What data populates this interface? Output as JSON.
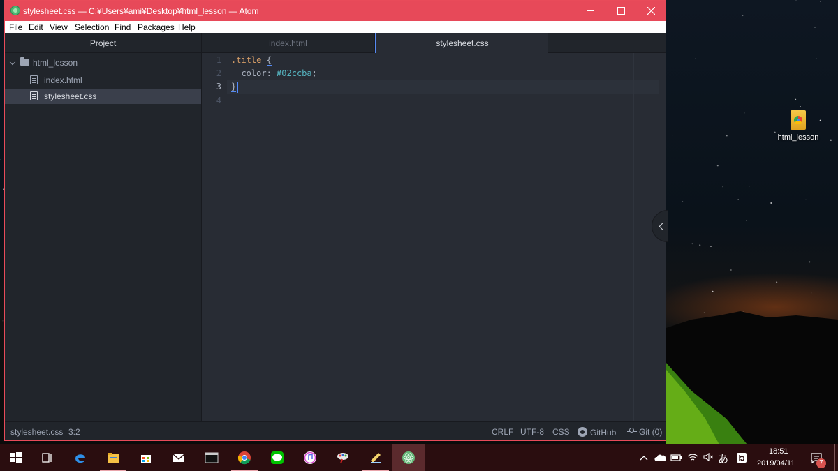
{
  "window": {
    "title": "stylesheet.css — C:¥Users¥ami¥Desktop¥html_lesson — Atom",
    "accent": "#e74959"
  },
  "menu": {
    "items": [
      "File",
      "Edit",
      "View",
      "Selection",
      "Find",
      "Packages",
      "Help"
    ]
  },
  "tree": {
    "header": "Project",
    "root": "html_lesson",
    "files": [
      {
        "name": "index.html",
        "selected": false
      },
      {
        "name": "stylesheet.css",
        "selected": true
      }
    ]
  },
  "tabs": [
    {
      "label": "index.html",
      "active": false
    },
    {
      "label": "stylesheet.css",
      "active": true
    }
  ],
  "editor": {
    "line_numbers": [
      "1",
      "2",
      "3",
      "4"
    ],
    "active_line": 3,
    "lines": [
      {
        "selector": ".title",
        "brace": "{"
      },
      {
        "prop": "color:",
        "value": "#02ccba",
        "end": ";"
      },
      {
        "brace": "}"
      },
      {}
    ]
  },
  "status": {
    "file": "stylesheet.css",
    "cursor": "3:2",
    "line_ending": "CRLF",
    "encoding": "UTF-8",
    "grammar": "CSS",
    "github": "GitHub",
    "git": "Git (0)"
  },
  "desktop": {
    "icon_label": "html_lesson"
  },
  "taskbar": {
    "apps": [
      "start-icon",
      "task-view-icon",
      "edge-icon",
      "file-explorer-icon",
      "store-icon",
      "mail-icon",
      "terminal-icon",
      "chrome-icon",
      "line-icon",
      "itunes-icon",
      "paint-icon",
      "notepad-icon",
      "atom-icon"
    ],
    "ime": "あ",
    "time": "18:51",
    "date": "2019/04/11",
    "notifications": "7"
  }
}
